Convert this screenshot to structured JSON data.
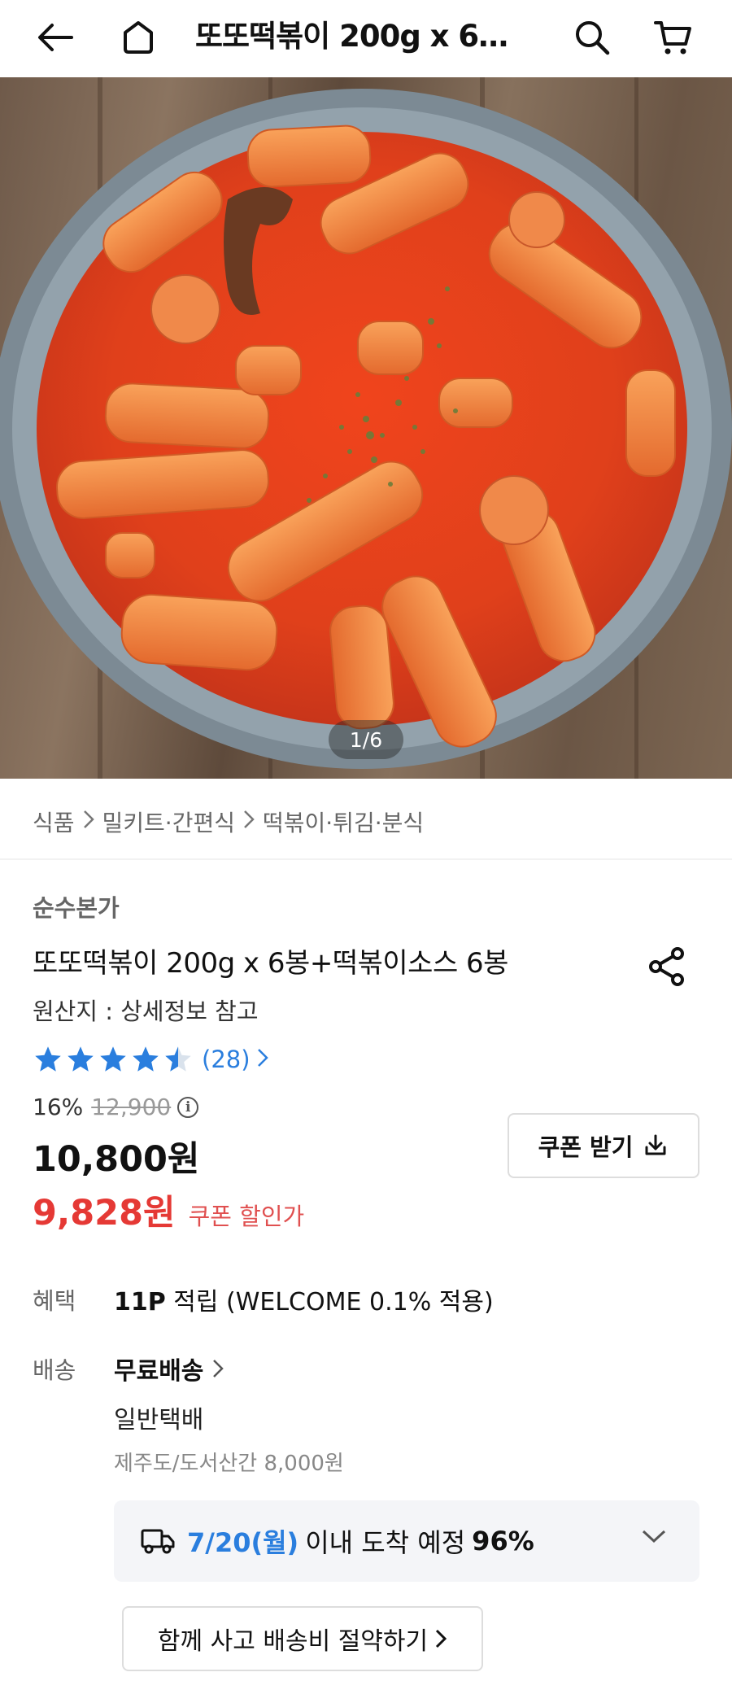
{
  "header": {
    "title": "또또떡볶이 200g x 6…",
    "icons": [
      "back-arrow-icon",
      "home-icon",
      "search-icon",
      "cart-icon"
    ]
  },
  "gallery": {
    "pager": "1/6"
  },
  "breadcrumb": {
    "items": [
      "식품",
      "밀키트·간편식",
      "떡볶이·튀김·분식"
    ]
  },
  "product": {
    "brand": "순수본가",
    "title": "또또떡볶이 200g x 6봉+떡볶이소스 6봉",
    "origin": "원산지 : 상세정보 참고",
    "rating": 4.5,
    "review_count": "(28)",
    "discount_rate": "16%",
    "original_price": "12,900",
    "info_icon": "i",
    "price": "10,800원",
    "coupon_price": "9,828원",
    "coupon_label": "쿠폰 할인가",
    "coupon_button": "쿠폰 받기"
  },
  "benefit": {
    "label": "혜택",
    "points": "11P",
    "text": " 적립 (WELCOME 0.1% 적용)"
  },
  "shipping": {
    "label": "배송",
    "fee": "무료배송",
    "type": "일반택배",
    "extra": "제주도/도서산간 8,000원",
    "eta_date": "7/20(월)",
    "eta_text": "이내 도착 예정",
    "eta_percent": "96%",
    "bundle_button": "함께 사고 배송비 절약하기"
  },
  "colors": {
    "accent_blue": "#2a7ede",
    "sale_red": "#e53935",
    "star_blue": "#2a7ede"
  }
}
